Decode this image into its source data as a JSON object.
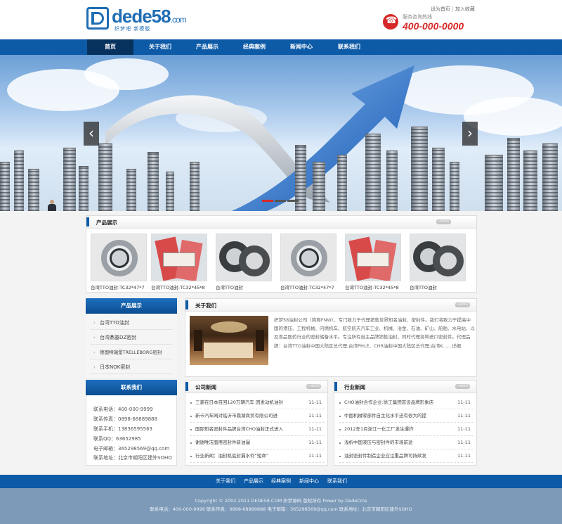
{
  "header": {
    "logo_text": "dede58",
    "logo_com": ".com",
    "logo_sub": "织梦吧 新模版",
    "toplink_home": "设为首页",
    "toplink_sep": "|",
    "toplink_fav": "加入收藏",
    "hotline_label": "服务咨询热线",
    "hotline_number": "400-000-0000"
  },
  "nav": {
    "items": [
      "首页",
      "关于我们",
      "产品展示",
      "经典案例",
      "新闻中心",
      "联系我们"
    ],
    "active_index": 0
  },
  "banner": {
    "prev_icon": "chevron-left-icon",
    "next_icon": "chevron-right-icon",
    "dot_count": 3,
    "active_dot": 0
  },
  "products": {
    "title": "产品展示",
    "more": "+MORE",
    "items": [
      {
        "caption": "台湾TTO油封-TC32*47*7",
        "kind": "metal"
      },
      {
        "caption": "台湾TTO油封-TC32*45*8",
        "kind": "bag"
      },
      {
        "caption": "台湾TTO油封",
        "kind": "ring"
      },
      {
        "caption": "台湾TTO油封-TC32*47*7",
        "kind": "metal"
      },
      {
        "caption": "台湾TTO油封-TC32*45*8",
        "kind": "bag"
      },
      {
        "caption": "台湾TTO油封",
        "kind": "ring"
      }
    ]
  },
  "sidebar": {
    "product_title": "产品展示",
    "product_items": [
      "台湾TTO油封",
      "台湾鼎基DZ密封",
      "德国特瑞堡TRELLEBORG密封",
      "日本NOK密封"
    ],
    "contact_title": "联系我们",
    "contact_lines": [
      "联系电话：400-000-9999",
      "联系传真：0898-68889888",
      "联系手机：13836595563",
      "联系QQ：63652985",
      "电子邮箱：365298569@qq.com",
      "联系地址：北京市朝阳区建外SOHO"
    ]
  },
  "about": {
    "title": "关于我们",
    "more": "+MORE",
    "text": "织梦58油封公司（简称FNW），专门致力于代理销售世界知名油封、密封件。我们将致力于提高中国的港压、工程机械、内燃机车、航空航天汽车工业、机械、冶金、石油、矿山、船舶、水电站、以及食品医药行业的密封储备水平。专注所有自主品牌销售油封，同时代理各种进口密封件。代理品牌：台湾TTO油封中国大陆区总代理;台湾PHLE、CHR油封中国大陆区总代理;台湾K......详细"
  },
  "company_news": {
    "title": "公司新闻",
    "more": "+MORE",
    "items": [
      {
        "title": "三菱在日本召回120万辆汽车 因发动机油封",
        "date": "11-11"
      },
      {
        "title": "新卡汽车网对临沂市鼎湖商贸有限公司进",
        "date": "11-11"
      },
      {
        "title": "国际知名密封件品牌台湾CHO油封正式进入",
        "date": "11-11"
      },
      {
        "title": "谢谢唯洁面用密封件新油漏",
        "date": "11-11"
      },
      {
        "title": "行业新闻：油封机底封漏水何“短命”",
        "date": "11-11"
      }
    ]
  },
  "industry_news": {
    "title": "行业新闻",
    "more": "+MORE",
    "items": [
      {
        "title": "CHO油封合作企业:徐工集团首设品牌形象店",
        "date": "11-11"
      },
      {
        "title": "中国机械零部件自主化水平还有很大的提",
        "date": "11-11"
      },
      {
        "title": "2012年1月浙江一化工厂发生爆炸",
        "date": "11-11"
      },
      {
        "title": "浅析中国液压与密封件的市场前途",
        "date": "11-11"
      },
      {
        "title": "油封密封件制造企业应注重品牌可持续发",
        "date": "11-11"
      }
    ]
  },
  "footer": {
    "nav": [
      "关于我们",
      "产品展示",
      "经典案例",
      "新闻中心",
      "联系我们"
    ],
    "copyright": "Copyright © 2002-2011 DEDE58.COM 织梦源码 版权所有 Power by DedeCms",
    "contact": "联系电话：400-000-9999 联系传真：0898-68889888 电子邮箱：365298569@qq.com 联系地址：北京市朝阳区建外SOHO"
  },
  "colors": {
    "brand_blue": "#0d5aa7",
    "nav_active": "#08325e",
    "hotline_red": "#d62828",
    "footer_bg": "#7d9ab8"
  }
}
